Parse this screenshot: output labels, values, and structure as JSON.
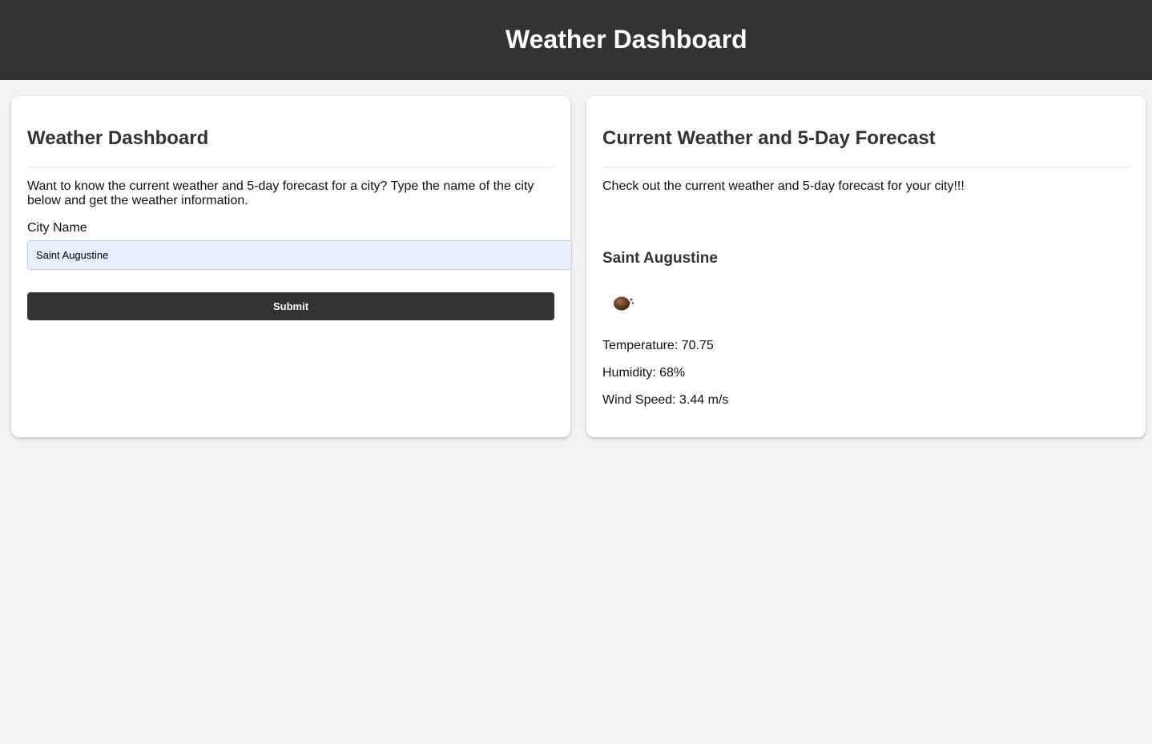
{
  "header": {
    "title": "Weather Dashboard"
  },
  "search_card": {
    "title": "Weather Dashboard",
    "description": "Want to know the current weather and 5-day forecast for a city? Type the name of the city below and get the weather information.",
    "city_label": "City Name",
    "city_value": "Saint Augustine",
    "submit_label": "Submit"
  },
  "forecast_card": {
    "title": "Current Weather and 5-Day Forecast",
    "description": "Check out the current weather and 5-day forecast for your city!!!",
    "city": "Saint Augustine",
    "icon": "few-clouds-icon",
    "temperature": "Temperature: 70.75",
    "humidity": "Humidity: 68%",
    "wind_speed": "Wind Speed: 3.44 m/s"
  },
  "colors": {
    "header_bg": "#333333",
    "page_bg": "#f3f3f3",
    "card_bg": "#ffffff",
    "input_bg": "#e8f0fe",
    "button_bg": "#333333",
    "button_text": "#ffffff"
  }
}
